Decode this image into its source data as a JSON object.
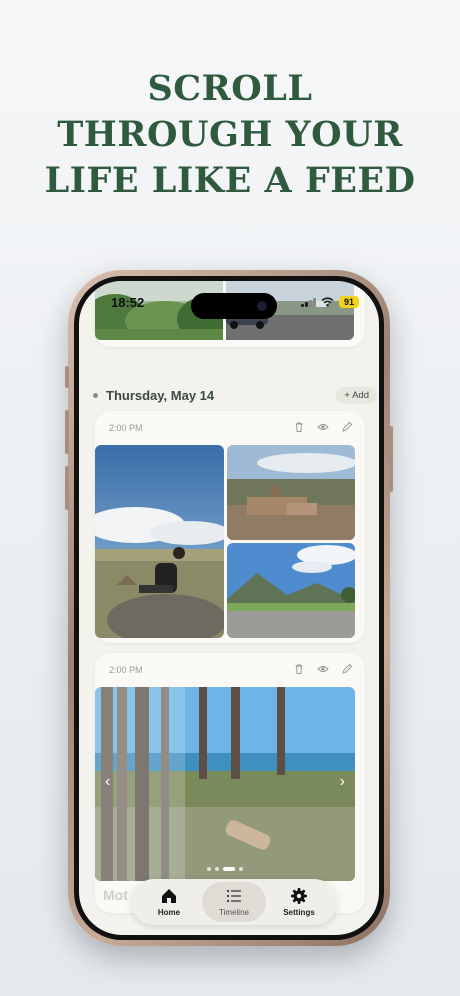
{
  "headline": {
    "line1": "SCROLL",
    "line2": "THROUGH YOUR",
    "line3": "LIFE LIKE A FEED"
  },
  "status_bar": {
    "time": "18:52",
    "battery": "91"
  },
  "timeline": {
    "date_header": "Thursday, May 14",
    "add_label": "+ Add",
    "entries": [
      {
        "time": "2:00 PM"
      },
      {
        "time": "2:00 PM"
      }
    ],
    "next_section_partial": "Mot"
  },
  "tabbar": {
    "home_label": "Home",
    "timeline_label": "Timeline",
    "settings_label": "Settings"
  },
  "colors": {
    "headline": "#2f5a3e",
    "screen_bg": "#f3f2ec",
    "card_bg": "#faf9f5",
    "battery": "#f3d21b"
  },
  "icons": [
    "trash-icon",
    "eye-icon",
    "pencil-icon",
    "home-icon",
    "list-icon",
    "gear-icon",
    "chevron-left-icon",
    "chevron-right-icon"
  ]
}
